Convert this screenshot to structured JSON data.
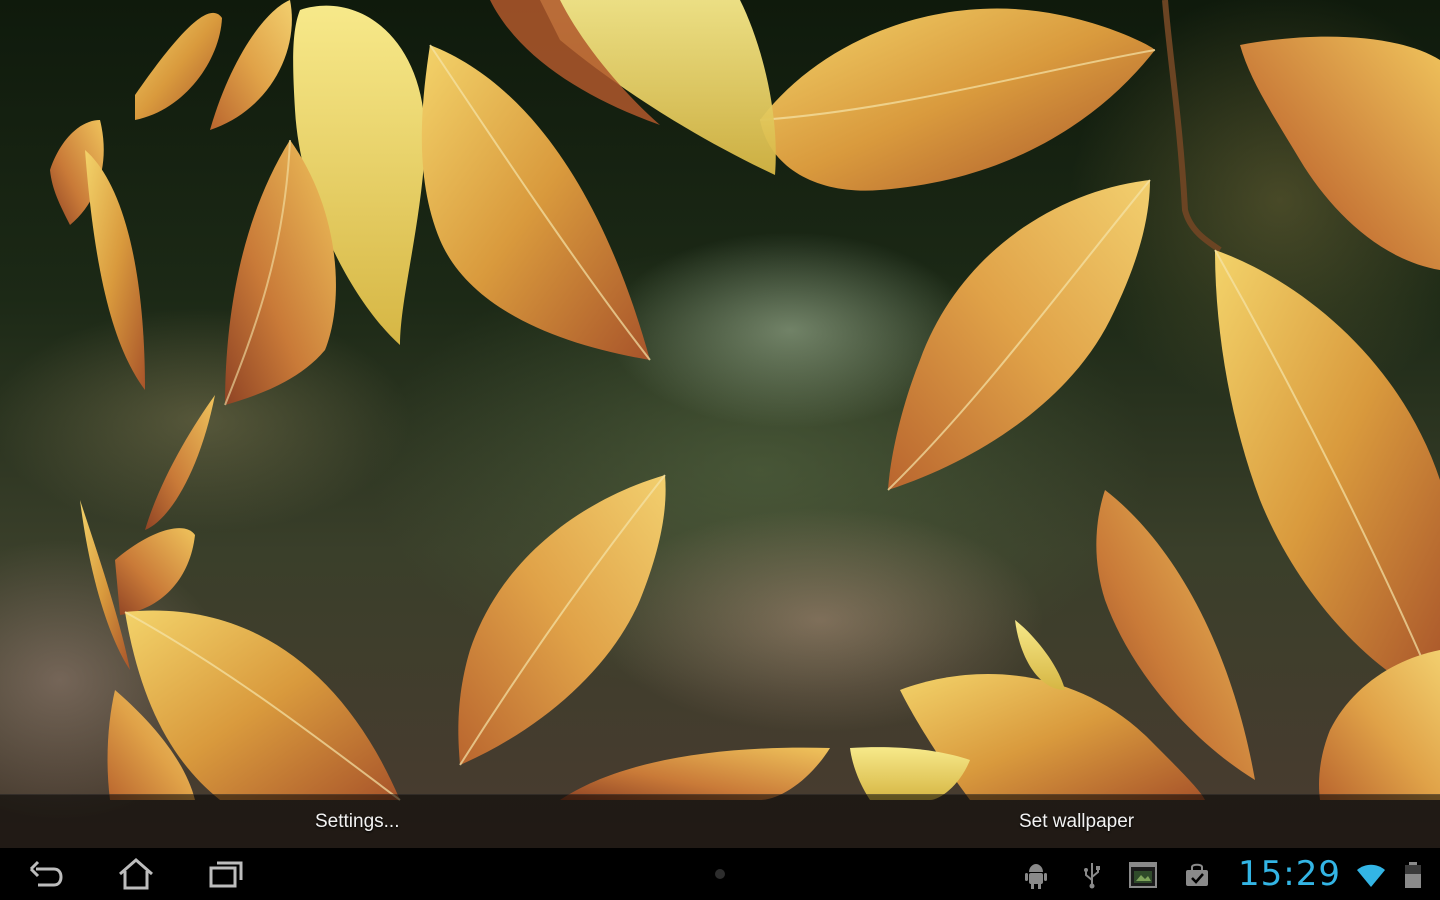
{
  "wallpaper_preview": {
    "icon": "autumn-leaves-image"
  },
  "action_bar": {
    "settings_label": "Settings...",
    "set_wallpaper_label": "Set wallpaper"
  },
  "system_bar": {
    "nav": [
      "back-icon",
      "home-icon",
      "recent-apps-icon"
    ],
    "status_icons": [
      "android-debug-icon",
      "usb-icon",
      "screenshot-icon",
      "shopping-bag-icon",
      "wifi-icon",
      "battery-icon"
    ],
    "clock": "15:29",
    "accent_color": "#33b5e5"
  }
}
